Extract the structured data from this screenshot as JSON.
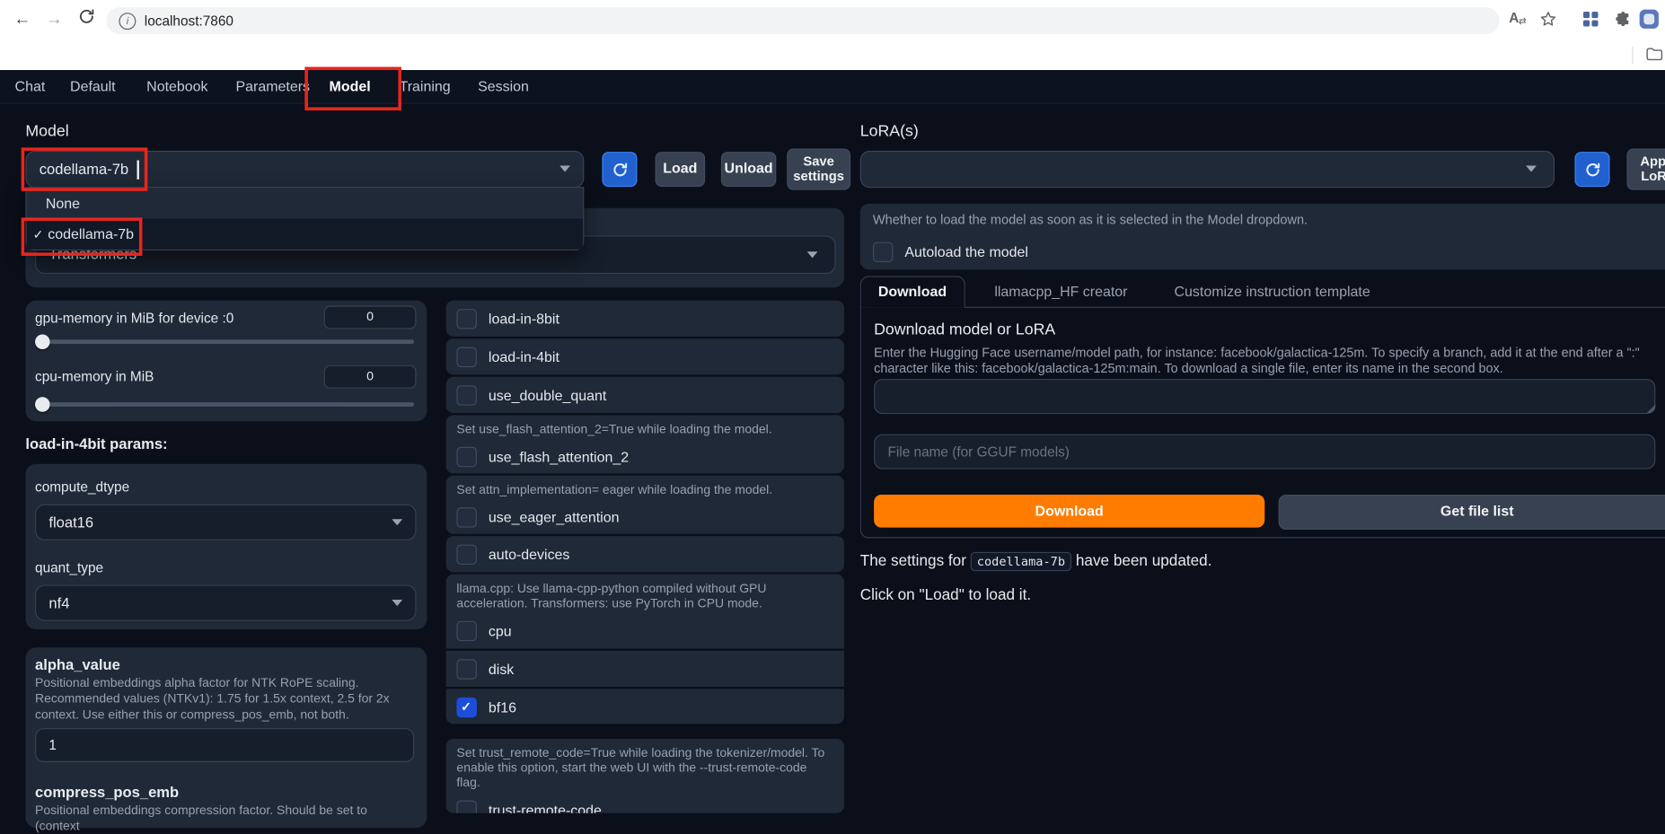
{
  "browser": {
    "url": "localhost:7860"
  },
  "main_tabs": {
    "items": [
      {
        "label": "Chat"
      },
      {
        "label": "Default"
      },
      {
        "label": "Notebook"
      },
      {
        "label": "Parameters"
      },
      {
        "label": "Model"
      },
      {
        "label": "Training"
      },
      {
        "label": "Session"
      }
    ],
    "selected": "Model"
  },
  "model": {
    "label": "Model",
    "value": "codellama-7b",
    "options": [
      {
        "label": "None",
        "selected": false,
        "check": ""
      },
      {
        "label": "codellama-7b",
        "selected": true,
        "check": "✓"
      }
    ],
    "load_button": "Load",
    "unload_button": "Unload",
    "save_settings_button": "Save settings",
    "loader_value": "Transformers"
  },
  "left_params": {
    "gpu_memory": {
      "label": "gpu-memory in MiB for device :0",
      "value": "0"
    },
    "cpu_memory": {
      "label": "cpu-memory in MiB",
      "value": "0"
    },
    "section_heading": "load-in-4bit params:",
    "compute_dtype": {
      "label": "compute_dtype",
      "value": "float16"
    },
    "quant_type": {
      "label": "quant_type",
      "value": "nf4"
    },
    "alpha_value": {
      "label": "alpha_value",
      "description": "Positional embeddings alpha factor for NTK RoPE scaling. Recommended values (NTKv1): 1.75 for 1.5x context, 2.5 for 2x context. Use either this or compress_pos_emb, not both.",
      "value": "1"
    },
    "compress_pos_emb": {
      "label": "compress_pos_emb",
      "description": "Positional embeddings compression factor. Should be set to (context"
    }
  },
  "flags": {
    "group1": {
      "items": [
        {
          "label": "load-in-8bit",
          "checked": false
        },
        {
          "label": "load-in-4bit",
          "checked": false
        },
        {
          "label": "use_double_quant",
          "checked": false
        }
      ]
    },
    "group2": {
      "info": "Set use_flash_attention_2=True while loading the model.",
      "items": [
        {
          "label": "use_flash_attention_2",
          "checked": false
        }
      ]
    },
    "group3": {
      "info": "Set attn_implementation= eager while loading the model.",
      "items": [
        {
          "label": "use_eager_attention",
          "checked": false
        }
      ]
    },
    "group4": {
      "items": [
        {
          "label": "auto-devices",
          "checked": false
        }
      ]
    },
    "group5": {
      "info": "llama.cpp: Use llama-cpp-python compiled without GPU acceleration. Transformers: use PyTorch in CPU mode.",
      "items": [
        {
          "label": "cpu",
          "checked": false
        },
        {
          "label": "disk",
          "checked": false
        },
        {
          "label": "bf16",
          "checked": true
        }
      ]
    },
    "group6": {
      "info": "Set trust_remote_code=True while loading the tokenizer/model. To enable this option, start the web UI with the --trust-remote-code flag.",
      "items": [
        {
          "label": "trust-remote-code",
          "checked": false
        }
      ]
    }
  },
  "lora": {
    "label": "LoRA(s)",
    "apply_button": "Apply LoRA"
  },
  "autoload": {
    "info": "Whether to load the model as soon as it is selected in the Model dropdown.",
    "label": "Autoload the model",
    "checked": false
  },
  "download_section": {
    "tabs": [
      {
        "label": "Download",
        "selected": true
      },
      {
        "label": "llamacpp_HF creator",
        "selected": false
      },
      {
        "label": "Customize instruction template",
        "selected": false
      }
    ],
    "heading": "Download model or LoRA",
    "description": "Enter the Hugging Face username/model path, for instance: facebook/galactica-125m. To specify a branch, add it at the end after a \":\" character like this: facebook/galactica-125m:main. To download a single file, enter its name in the second box.",
    "model_input_value": "",
    "file_input_placeholder": "File name (for GGUF models)",
    "download_button": "Download",
    "get_file_list_button": "Get file list"
  },
  "status": {
    "line1_prefix": "The settings for ",
    "line1_code": "codellama-7b",
    "line1_suffix": " have been updated.",
    "line2": "Click on \"Load\" to load it."
  },
  "colors": {
    "accent_orange": "#ff7c00",
    "accent_blue": "#2160cf",
    "checked_blue": "#1d4ed8",
    "annotation_red": "#e8251f"
  }
}
